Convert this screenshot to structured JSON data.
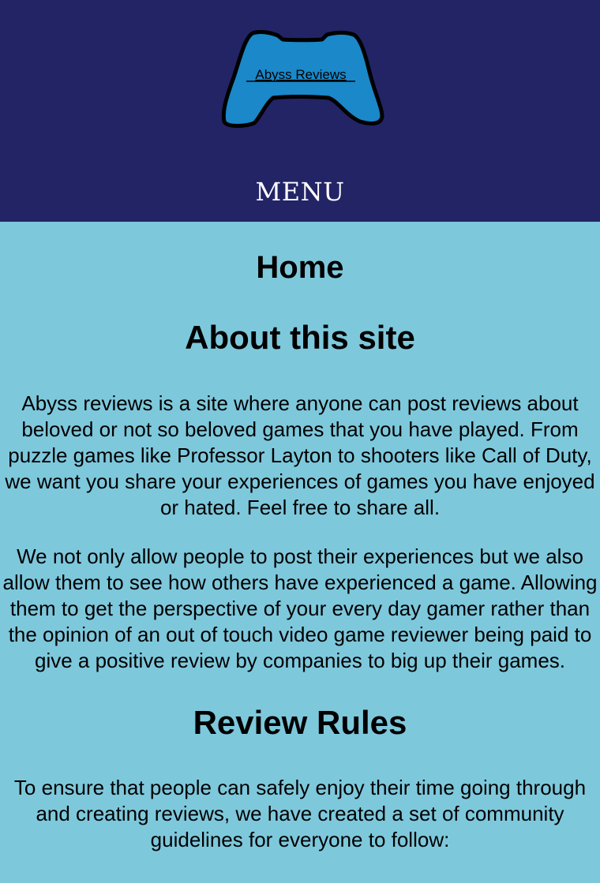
{
  "header": {
    "logo_text": "Abyss Reviews",
    "menu_label": "MENU"
  },
  "main": {
    "page_title": "Home",
    "about_heading": "About this site",
    "about_paragraph_1": "Abyss reviews is a site where anyone can post reviews about beloved or not so beloved games that you have played. From puzzle games like Professor Layton to shooters like Call of Duty, we want you share your experiences of games you have enjoyed or hated. Feel free to share all.",
    "about_paragraph_2": "We not only allow people to post their experiences but we also allow them to see how others have experienced a game. Allowing them to get the perspective of your every day gamer rather than the opinion of an out of touch video game reviewer being paid to give a positive review by companies to big up their games.",
    "rules_heading": "Review Rules",
    "rules_paragraph": "To ensure that people can safely enjoy their time going through and creating reviews, we have created a set of community guidelines for everyone to follow:"
  },
  "colors": {
    "header_bg": "#222466",
    "page_bg": "#7ec8dc",
    "logo_fill": "#1a88c9"
  }
}
